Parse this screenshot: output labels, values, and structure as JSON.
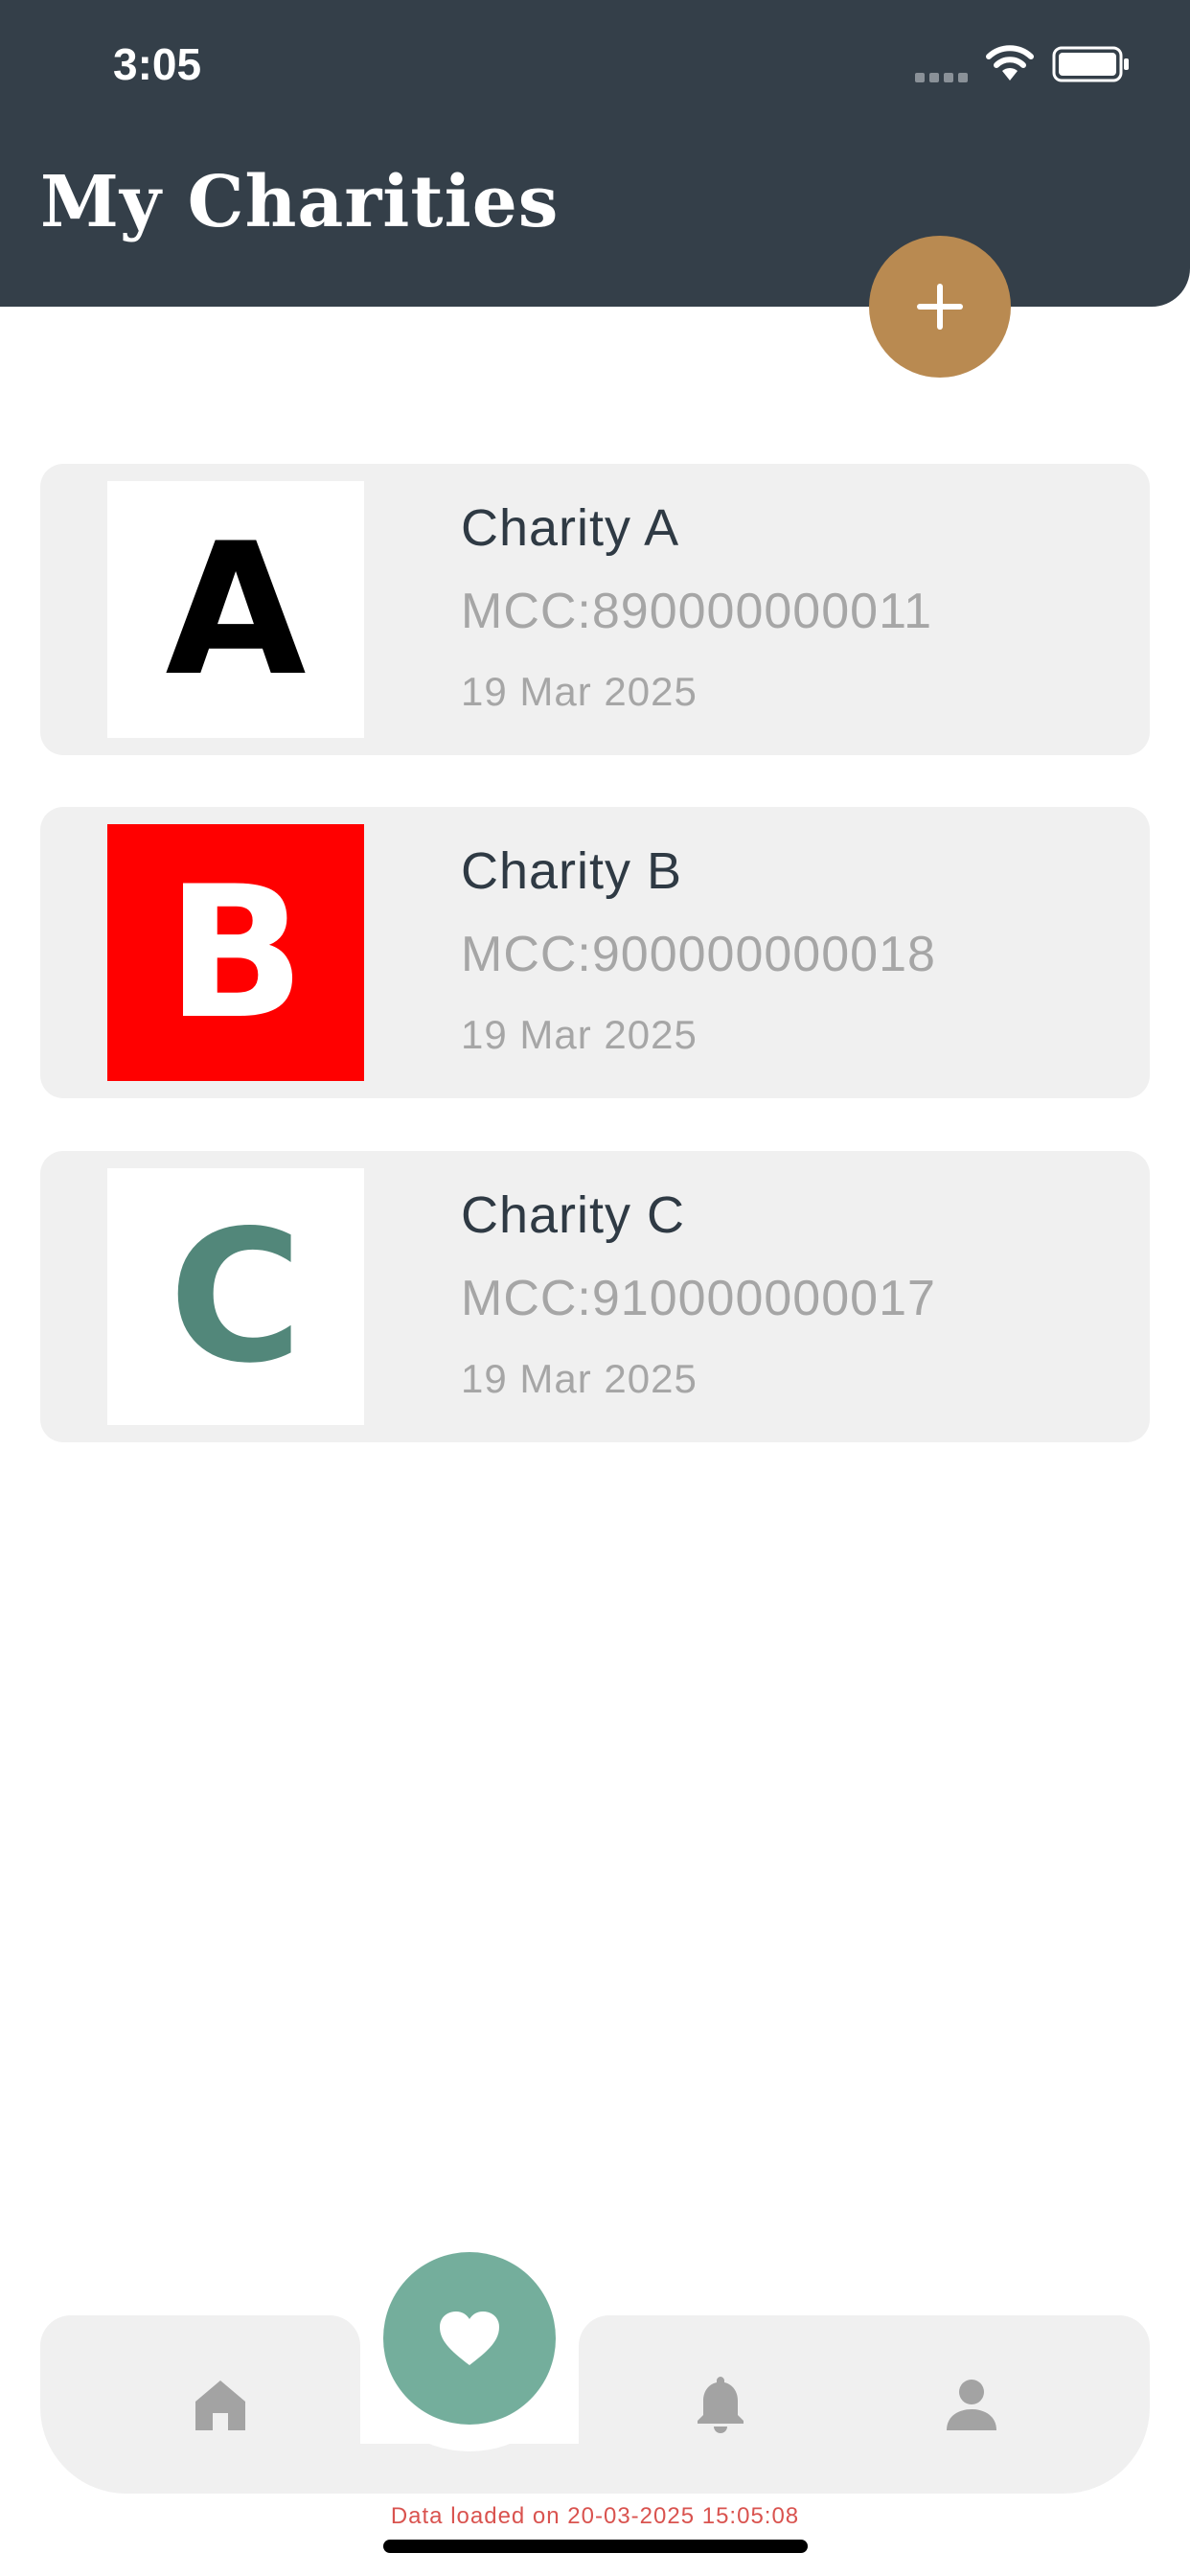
{
  "status_bar": {
    "time": "3:05"
  },
  "header": {
    "title": "My Charities"
  },
  "add_button": {
    "icon": "plus-icon"
  },
  "charities": [
    {
      "name": "Charity A",
      "mcc": "MCC:890000000011",
      "date": "19 Mar 2025",
      "logo_letter": "A",
      "logo_bg": "#ffffff",
      "logo_fg": "#000000"
    },
    {
      "name": "Charity B",
      "mcc": "MCC:900000000018",
      "date": "19 Mar 2025",
      "logo_letter": "B",
      "logo_bg": "#ff0000",
      "logo_fg": "#ffffff"
    },
    {
      "name": "Charity C",
      "mcc": "MCC:910000000017",
      "date": "19 Mar 2025",
      "logo_letter": "C",
      "logo_bg": "#ffffff",
      "logo_fg": "#52877a"
    }
  ],
  "bottom_nav": {
    "items": [
      {
        "icon": "home-icon"
      },
      {
        "icon": "heart-icon",
        "active": true
      },
      {
        "icon": "bell-icon"
      },
      {
        "icon": "person-icon"
      }
    ]
  },
  "footer": {
    "text": "Data loaded on 20-03-2025 15:05:08"
  },
  "colors": {
    "header_bg": "#343f49",
    "accent_gold": "#b98a51",
    "accent_green": "#74ae9c",
    "card_bg": "#f0f0f0",
    "footer_text": "#d9534f"
  }
}
